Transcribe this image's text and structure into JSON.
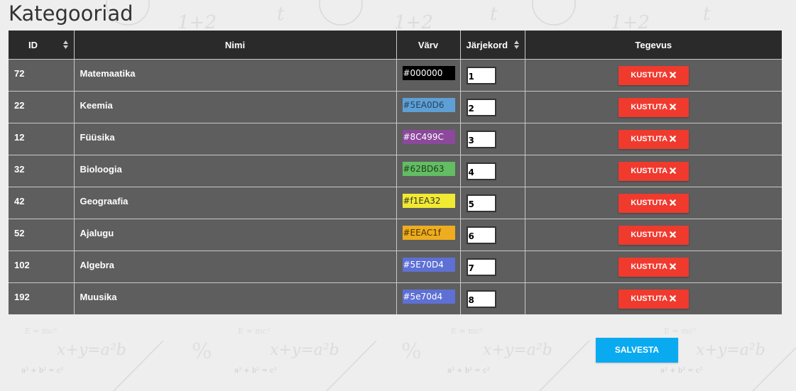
{
  "page": {
    "title": "Kategooriad"
  },
  "table": {
    "headers": {
      "id": "ID",
      "name": "Nimi",
      "color": "Värv",
      "order": "Järjekord",
      "action": "Tegevus"
    },
    "rows": [
      {
        "id": "72",
        "name": "Matemaatika",
        "color": "#000000",
        "color_text": "#fff",
        "order": "1",
        "action": "KUSTUTA"
      },
      {
        "id": "22",
        "name": "Keemia",
        "color": "#5EA0D6",
        "color_text": "#27435e",
        "order": "2",
        "action": "KUSTUTA"
      },
      {
        "id": "12",
        "name": "Füüsika",
        "color": "#8C499C",
        "color_text": "#fff",
        "order": "3",
        "action": "KUSTUTA"
      },
      {
        "id": "32",
        "name": "Bioloogia",
        "color": "#62BD63",
        "color_text": "#1e3d1e",
        "order": "4",
        "action": "KUSTUTA"
      },
      {
        "id": "42",
        "name": "Geograafia",
        "color": "#f1EA32",
        "color_text": "#333",
        "order": "5",
        "action": "KUSTUTA"
      },
      {
        "id": "52",
        "name": "Ajalugu",
        "color": "#EEAC1f",
        "color_text": "#4a3300",
        "order": "6",
        "action": "KUSTUTA"
      },
      {
        "id": "102",
        "name": "Algebra",
        "color": "#5E70D4",
        "color_text": "#fff",
        "order": "7",
        "action": "KUSTUTA"
      },
      {
        "id": "192",
        "name": "Muusika",
        "color": "#5e70d4",
        "color_text": "#fff",
        "order": "8",
        "action": "KUSTUTA"
      }
    ]
  },
  "save_label": "SALVESTA",
  "icons": {
    "sort": "sort-icon",
    "delete": "close-icon"
  },
  "colors": {
    "header_bg": "#2a2a2a",
    "row_bg": "#5e5e5e",
    "delete": "#f03a2e",
    "save": "#0aaaf0"
  }
}
